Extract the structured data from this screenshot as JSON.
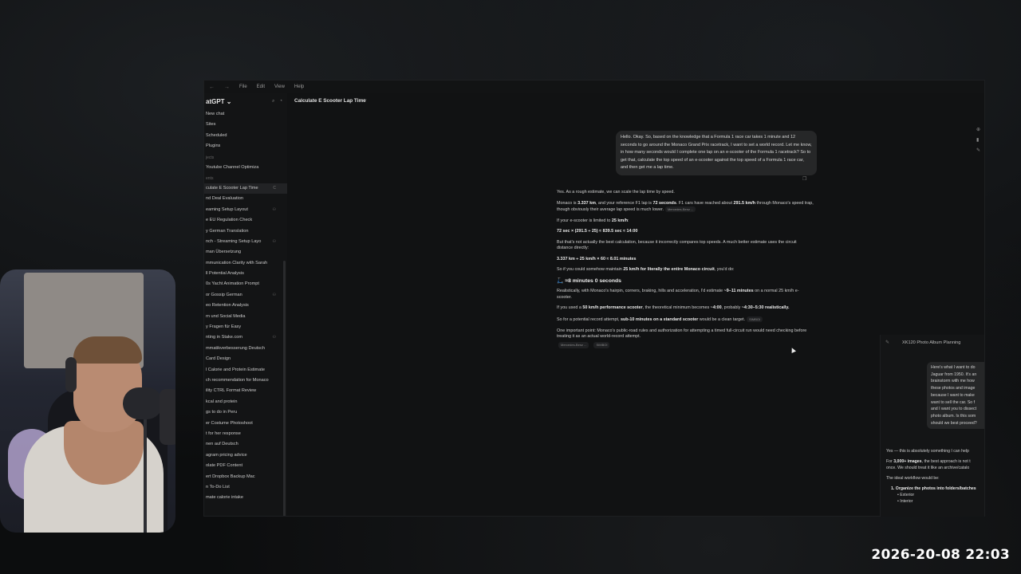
{
  "menubar": {
    "nav_back": "←",
    "nav_forward": "→",
    "items": [
      "File",
      "Edit",
      "View",
      "Help"
    ]
  },
  "sidebar": {
    "title": "atGPT ⌄",
    "top_items": [
      "New chat",
      "Sites",
      "Scheduled",
      "Plugins"
    ],
    "projects_label": "jects",
    "projects": [
      "Youtube Channel Optimiza"
    ],
    "chats_label": "ents",
    "chats": [
      "culate E Scooter Lap Time",
      "nd Deal Evaluation",
      "eaming Setup Layout",
      "e EU Regulation Check",
      "y German Translation",
      "nch - Streaming Setup Layo",
      "man Übersetzung",
      "mmunication Clarity with Sarah",
      "ll Potential Analysis",
      "0s Yacht Animation Prompt",
      "or Gossip German",
      "eo Retention Analysis",
      "rn und Social Media",
      "y Fragen für Easy",
      "nting in Stake.com",
      "mmatikverbesserung Deutsch",
      "Card Design",
      "l Calorie and Protein Estimate",
      "ch recommendation for Monaco",
      "ility CTRL Format Review",
      "kcal and protein",
      "gs to do in Peru",
      "er Costume Photoshoot",
      "t for her response",
      "nen auf Deutsch",
      "agram pricing advice",
      "olate PDF Content",
      "ert Dropbox Backup Mac",
      "n To-Do List",
      "mate calorie intake"
    ]
  },
  "main": {
    "chat_title": "Calculate E Scooter Lap Time",
    "title_menu": "···",
    "user_message": "Hello. Okay. So, based on the knowledge that a Formula 1 race car takes 1 minute and 12 seconds to go around the Monaco Grand Prix racetrack, I want to set a world record. Let me know, in how many seconds would I complete one lap on an e-scooter of the Formula 1 racetrack? So to get that, calculate the top speed of an e-scooter against the top speed of a Formula 1 race car, and then get me a lap time.",
    "answer": {
      "p1": "Yes. As a rough estimate, we can scale the lap time by speed.",
      "p2_a": "Monaco is ",
      "p2_b": "3.337 km",
      "p2_c": ", and your reference F1 lap is ",
      "p2_d": "72 seconds",
      "p2_e": ". F1 cars have reached about ",
      "p2_f": "291.5 km/h",
      "p2_g": " through Monaco's speed trap, though obviously their average lap speed is much lower.",
      "chip1": "Mercedes-Benz ...",
      "p3_a": "If your e-scooter is limited to ",
      "p3_b": "25 km/h",
      "p3_c": ":",
      "calc1": "72 sec × (291.5 ÷ 25) ≈ 839.5 sec ≈ 14:00",
      "p4": "But that's not actually the best calculation, because it incorrectly compares top speeds. A much better estimate uses the circuit distance directly:",
      "calc2": "3.337 km ÷ 25 km/h × 60 ≈ 8.01 minutes",
      "p5_a": "So if you could somehow maintain ",
      "p5_b": "25 km/h for literally the entire Monaco circuit",
      "p5_c": ", you'd do:",
      "result": "≈8 minutes 0 seconds",
      "p6_a": "Realistically, with Monaco's hairpin, corners, braking, hills and acceleration, I'd estimate ",
      "p6_b": "~9–11 minutes",
      "p6_c": " on a normal 25 km/h e-scooter.",
      "p7_a": "If you used a ",
      "p7_b": "50 km/h performance scooter",
      "p7_c": ", the theoretical minimum becomes ",
      "p7_d": "~4:00",
      "p7_e": ", probably ",
      "p7_f": "~4:30–5:30 realistically.",
      "p8_a": "So for a potential record attempt, ",
      "p8_b": "sub-10 minutes on a standard scooter",
      "p8_c": " would be a clean target.",
      "chip2": "SIMBOI",
      "p9": "One important point: Monaco's public-road rules and authorization for attempting a timed full-circuit run would need checking before treating it as an actual world-record attempt.",
      "chip3": "Mercedes-Benz ...",
      "chip4": "SIMBOI"
    }
  },
  "side_panel": {
    "title": "XK120 Photo Album Planning",
    "user_lines": [
      "Here's what I want to do",
      "Jaguar from 1950. It's an",
      "brainstorm with me how",
      "these photos and image",
      "because I want to make",
      "want to sell the car. So f",
      "and I want you to dissect",
      "photo album. Is this som",
      "should we best proceed?"
    ],
    "answer_p1": "Yes — this is absolutely something I can help",
    "answer_p2_a": "For ",
    "answer_p2_b": "3,000+ images",
    "answer_p2_c": ", the best approach is not t",
    "answer_p3": "once. We should treat it like an archive/catalo",
    "answer_p4": "The ideal workflow would be:",
    "list_1": "1. Organize the photos into folders/batches",
    "sub_1": "• Exterior",
    "sub_2": "• Interior"
  },
  "overlay": {
    "timestamp": "2026-20-08 22:03"
  }
}
